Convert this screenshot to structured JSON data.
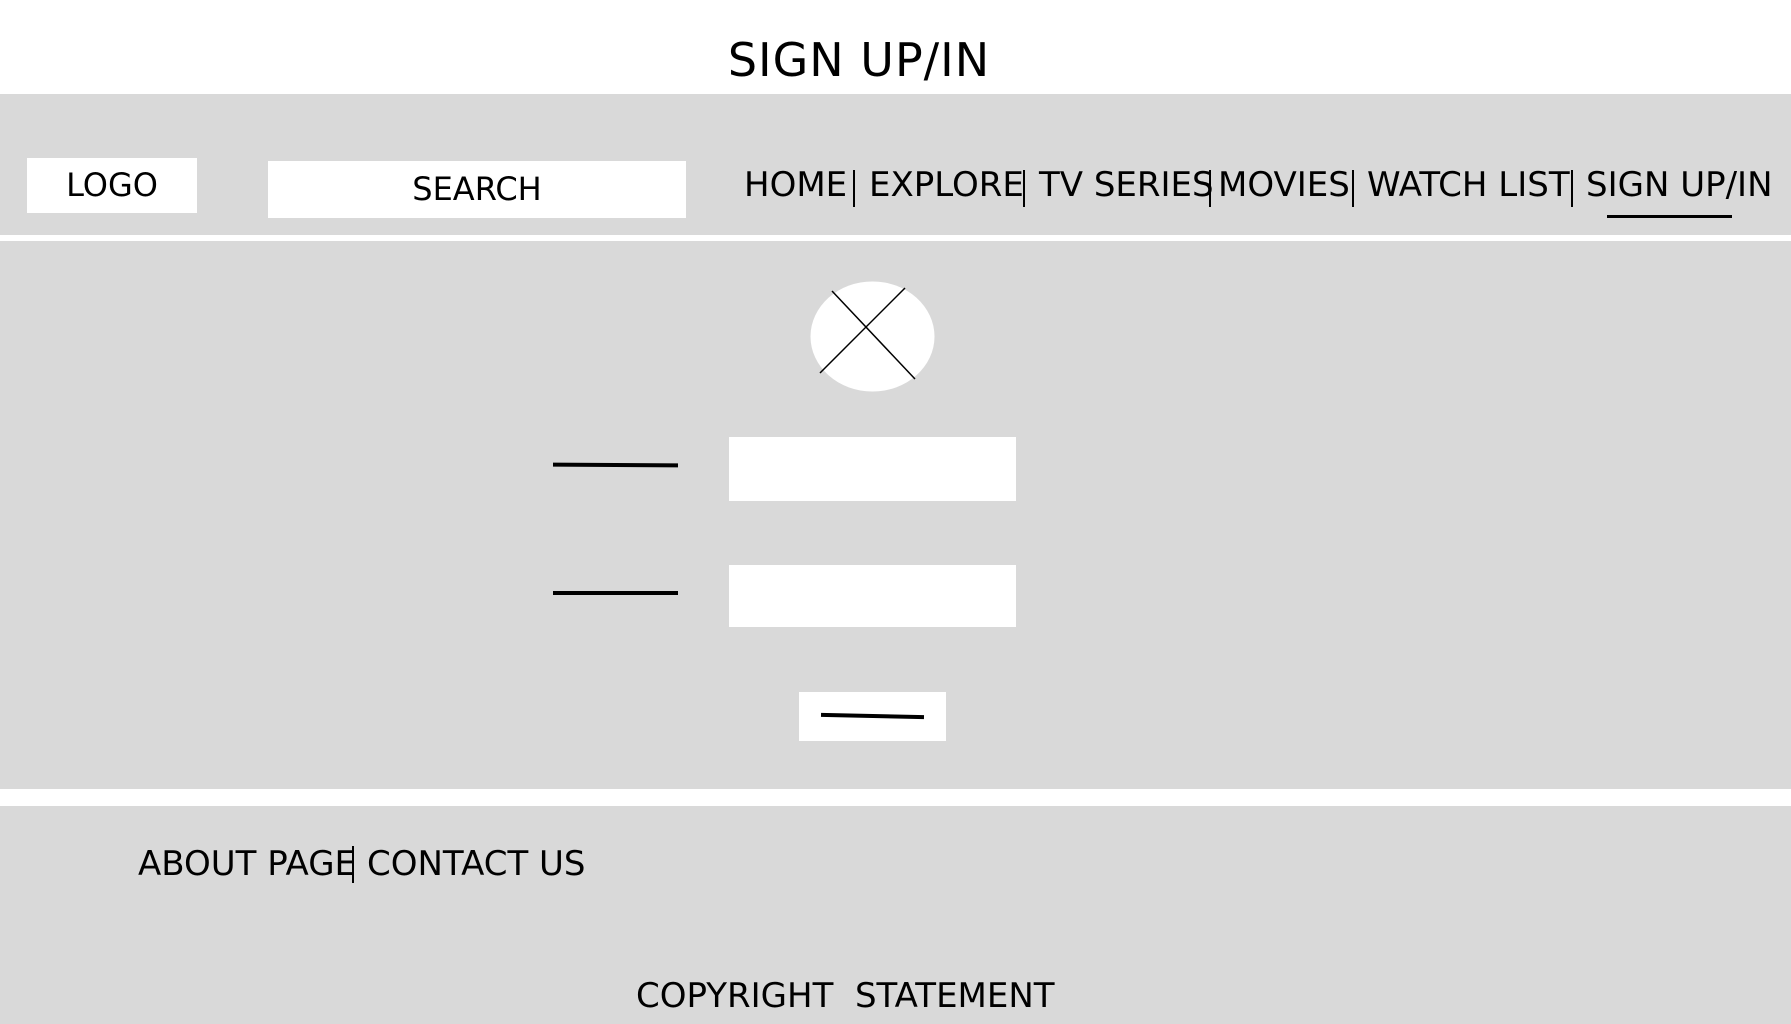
{
  "page": {
    "title": "SIGN UP/IN"
  },
  "header": {
    "logo": "LOGO",
    "search_placeholder": "SEARCH",
    "nav": [
      {
        "label": "HOME"
      },
      {
        "label": "EXPLORE"
      },
      {
        "label": "TV SERIES"
      },
      {
        "label": "MOVIES"
      },
      {
        "label": "WATCH LIST"
      },
      {
        "label": "SIGN UP/IN",
        "active": true
      }
    ]
  },
  "form": {
    "avatar_icon": "image-placeholder-icon",
    "fields": [
      {
        "value": ""
      },
      {
        "value": ""
      }
    ]
  },
  "footer": {
    "links": [
      {
        "label": "ABOUT PAGE"
      },
      {
        "label": "CONTACT US"
      }
    ],
    "copyright": "COPYRIGHT  STATEMENT"
  },
  "colors": {
    "panel": "#d9d9d9",
    "surface": "#ffffff",
    "ink": "#000000"
  }
}
